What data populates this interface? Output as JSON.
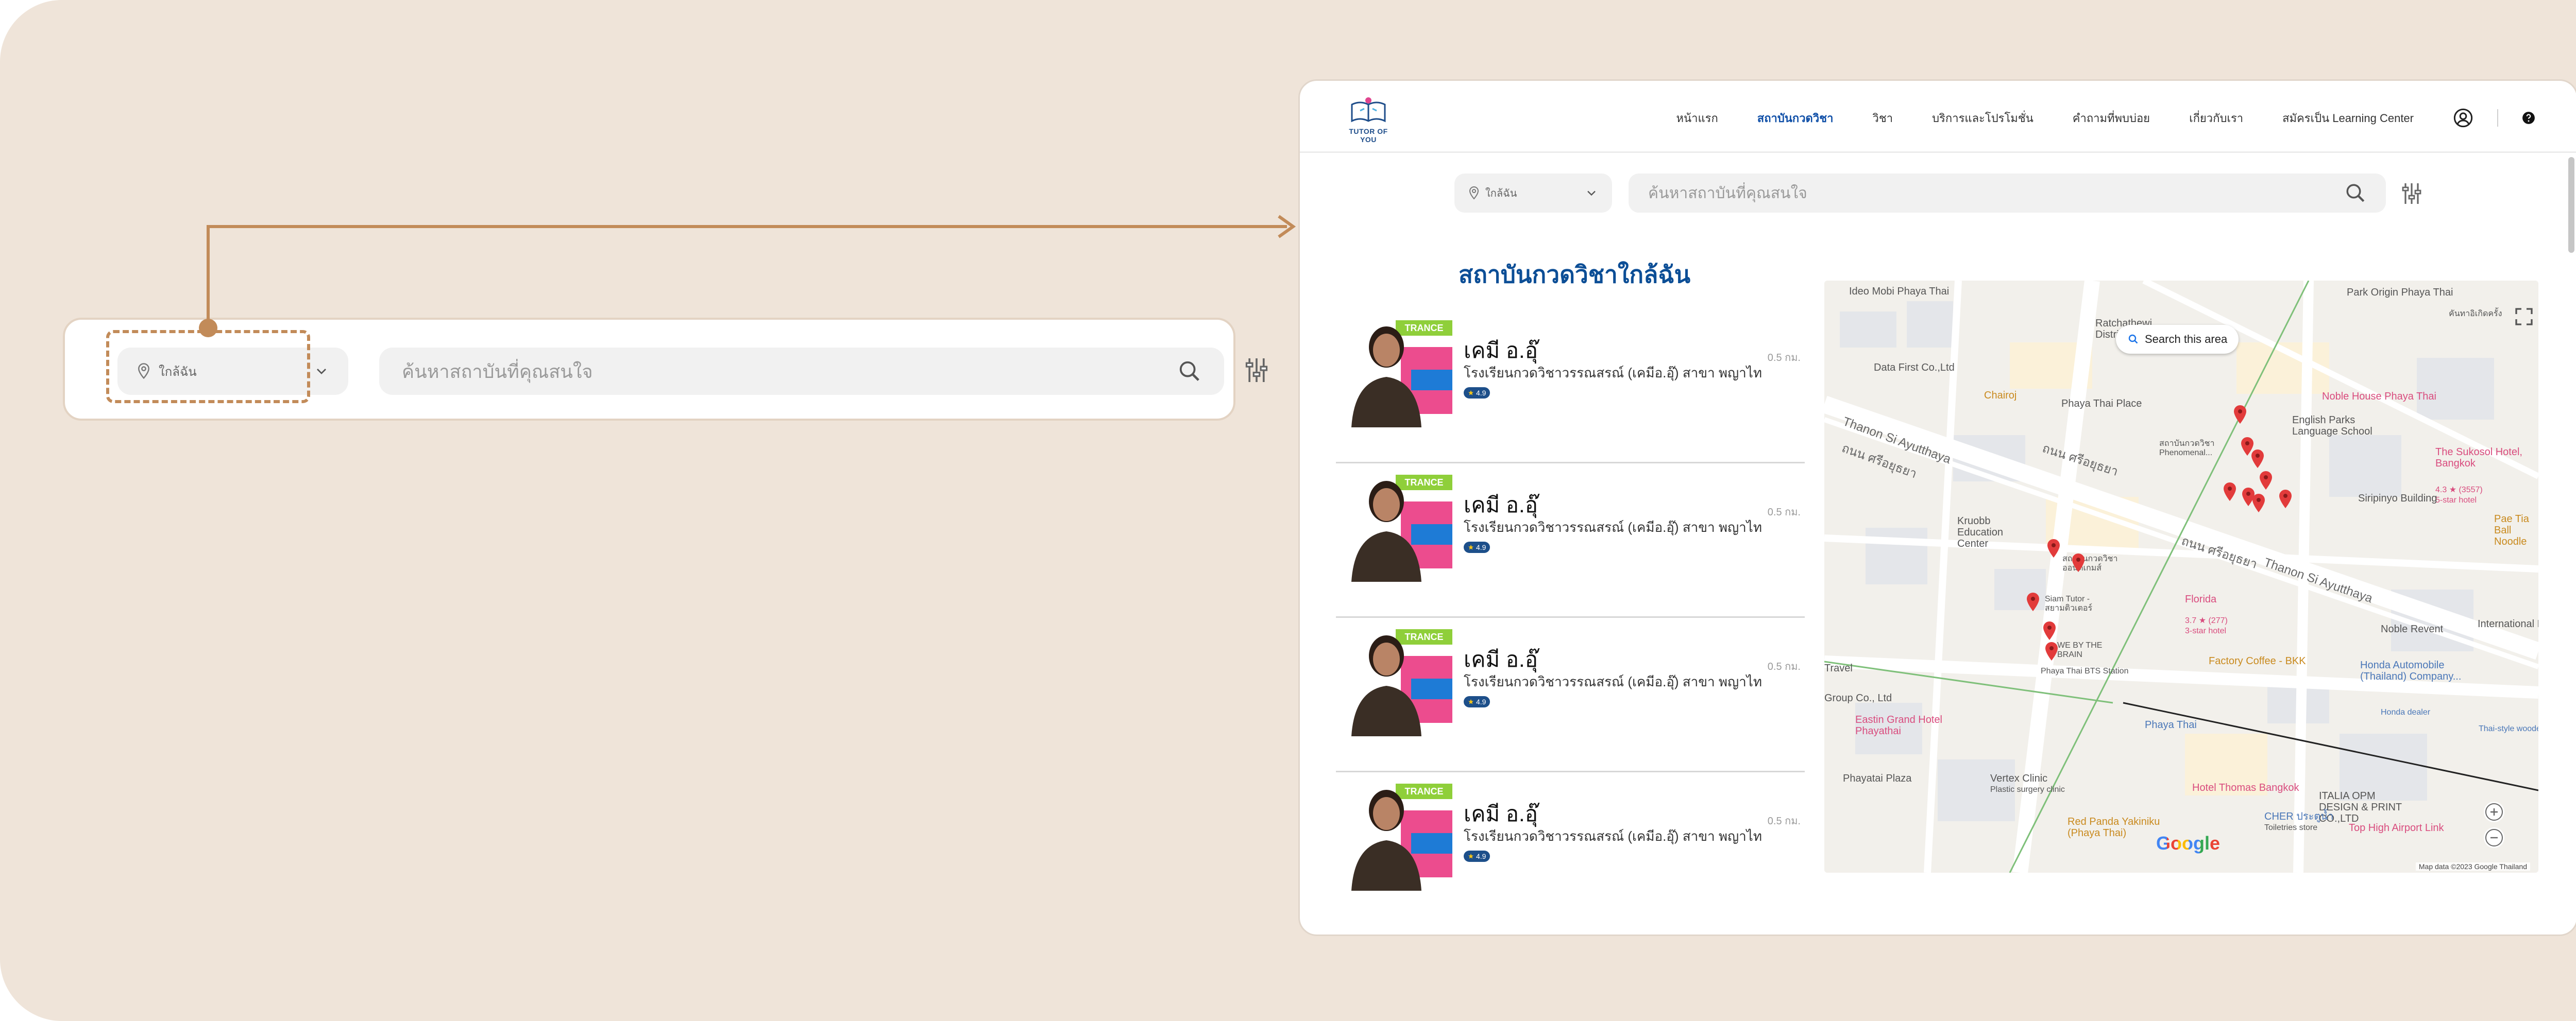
{
  "colors": {
    "background": "#efe4d9",
    "callout_accent": "#c28b59",
    "brand_blue": "#0c4e96",
    "nav_active": "#0e4ea7",
    "input_bg": "#f1f1f1",
    "pin_red": "#e23b3b"
  },
  "callout": {
    "location_label": "ใกล้ฉัน",
    "search_placeholder": "ค้นหาสถาบันที่คุณสนใจ",
    "icons": [
      "location-pin-icon",
      "chevron-down-icon",
      "search-icon",
      "filter-icon"
    ]
  },
  "header": {
    "logo_text": "TUTOR OF YOU",
    "nav": [
      {
        "label": "หน้าแรก",
        "active": false
      },
      {
        "label": "สถาบันกวดวิชา",
        "active": true
      },
      {
        "label": "วิชา",
        "active": false
      },
      {
        "label": "บริการและโปรโมชั่น",
        "active": false
      },
      {
        "label": "คำถามที่พบบ่อย",
        "active": false
      },
      {
        "label": "เกี่ยวกับเรา",
        "active": false
      },
      {
        "label": "สมัครเป็น Learning Center",
        "active": false
      }
    ]
  },
  "search": {
    "location_label": "ใกล้ฉัน",
    "placeholder": "ค้นหาสถาบันที่คุณสนใจ"
  },
  "section_title": "สถาบันกวดวิชาใกล้ฉัน",
  "results": [
    {
      "name": "เคมี อ.อุ๊",
      "school": "โรงเรียนกวดวิชาวรรณสรณ์ (เคมีอ.อุ๊) สาขา พญาไท",
      "rating": "4.9",
      "distance": "0.5 กม.",
      "banner": "TRANCE"
    },
    {
      "name": "เคมี อ.อุ๊",
      "school": "โรงเรียนกวดวิชาวรรณสรณ์ (เคมีอ.อุ๊) สาขา พญาไท",
      "rating": "4.9",
      "distance": "0.5 กม.",
      "banner": "TRANCE"
    },
    {
      "name": "เคมี อ.อุ๊",
      "school": "โรงเรียนกวดวิชาวรรณสรณ์ (เคมีอ.อุ๊) สาขา พญาไท",
      "rating": "4.9",
      "distance": "0.5 กม.",
      "banner": "TRANCE"
    },
    {
      "name": "เคมี อ.อุ๊",
      "school": "โรงเรียนกวดวิชาวรรณสรณ์ (เคมีอ.อุ๊) สาขา พญาไท",
      "rating": "4.9",
      "distance": "0.5 กม.",
      "banner": "TRANCE"
    }
  ],
  "map": {
    "search_area_label": "Search this area",
    "google_logo": "Google",
    "attribution": "Map data ©2023 Google   Thailand",
    "labels": {
      "l1": "Ideo Mobi Phaya Thai",
      "l2": "Ratchathewi District Office",
      "l3": "Park Origin Phaya Thai",
      "l4": "Data First Co.,Ltd",
      "l5": "Chairoj",
      "l6": "Phaya Thai Place",
      "l7": "English Parks Language School",
      "l8": "Noble House Phaya Thai",
      "l9": "The Sukosol Hotel, Bangkok",
      "l10": "4.3 ★ (3557)",
      "l11": "5-star hotel",
      "l12": "Thanon Si Ayutthaya",
      "l13": "ถนน ศรีอยุธยา",
      "l14": "สถาบันกวดวิชา Phenomenal...",
      "l15": "Siripinyo Building",
      "l16": "Kruobb Education Center",
      "l17": "สถาบันกวดวิชา ออนดีเกมส์",
      "l18": "Pae Tia Ball Noodle",
      "l19": "Siam Tutor - สยามติวเตอร์",
      "l20": "Florida",
      "l21": "3.7 ★ (277)",
      "l22": "3-star hotel",
      "l23": "Noble Revent",
      "l24": "WE BY THE BRAIN",
      "l25": "Phaya Thai BTS Station",
      "l26": "Factory Coffee - BKK",
      "l27": "Honda Automobile (Thailand) Company...",
      "l28": "International Li...",
      "l29": "Eastin Grand Hotel Phayathai",
      "l30": "Phaya Thai",
      "l31": "Phayatai Plaza",
      "l32": "Vertex Clinic",
      "l33": "Hotel Thomas Bangkok",
      "l34": "ITALIA OPM DESIGN & PRINT CO.,LTD",
      "l35": "CHER ประตูน้ำ",
      "l36": "Top High Airport Link",
      "l37": "Red Panda Yakiniku (Phaya Thai)",
      "l38": "Group Co., Ltd",
      "l39": "Travel",
      "l40": "Thai-style wooden",
      "l41": "คันทาอิเกิดครั้ง",
      "l42": "Honda dealer",
      "l43": "Plastic surgery clinic",
      "l44": "Toiletries store"
    }
  }
}
